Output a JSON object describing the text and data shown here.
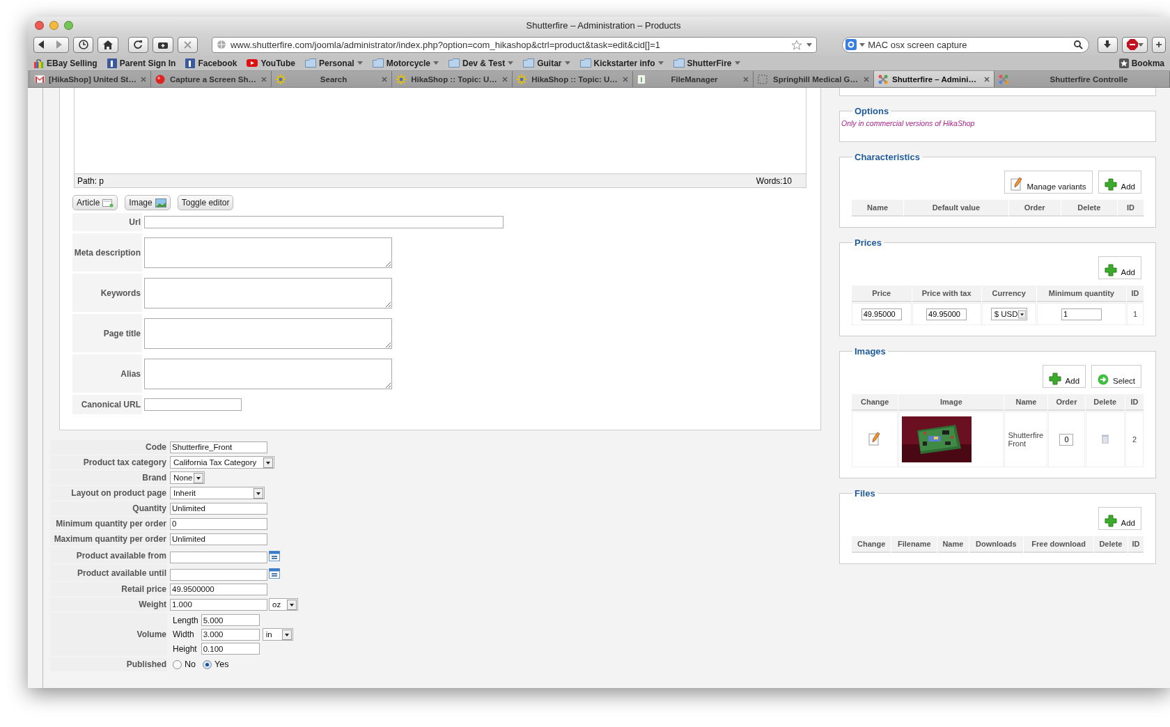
{
  "window": {
    "title": "Shutterfire – Administration – Products"
  },
  "toolbar": {
    "url": "www.shutterfire.com/joomla/administrator/index.php?option=com_hikashop&ctrl=product&task=edit&cid[]=1",
    "search": "MAC osx screen capture"
  },
  "bookmarks": [
    {
      "label": "EBay Selling",
      "kind": "bag"
    },
    {
      "label": "Parent Sign In",
      "kind": "square"
    },
    {
      "label": "Facebook",
      "kind": "square"
    },
    {
      "label": "YouTube",
      "kind": "play"
    },
    {
      "label": "Personal",
      "kind": "folder"
    },
    {
      "label": "Motorcycle",
      "kind": "folder"
    },
    {
      "label": "Dev & Test",
      "kind": "folder"
    },
    {
      "label": "Guitar",
      "kind": "folder"
    },
    {
      "label": "Kickstarter info",
      "kind": "folder"
    },
    {
      "label": "ShutterFire",
      "kind": "folder"
    }
  ],
  "bookmarks_menu": "Bookma",
  "tabs": [
    {
      "label": "[HikaShop] United St…",
      "selected": false
    },
    {
      "label": "Capture a Screen Sh…",
      "selected": false
    },
    {
      "label": "Search",
      "selected": false
    },
    {
      "label": "HikaShop :: Topic: U…",
      "selected": false
    },
    {
      "label": "HikaShop :: Topic: U…",
      "selected": false
    },
    {
      "label": "FileManager",
      "selected": false
    },
    {
      "label": "Springhill Medical G…",
      "selected": false
    },
    {
      "label": "Shutterfire – Admini…",
      "selected": true
    },
    {
      "label": "Shutterfire Controlle",
      "selected": false
    }
  ],
  "editor": {
    "path": "Path: p",
    "words": "Words:10",
    "buttons": [
      "Article",
      "Image",
      "Toggle editor"
    ]
  },
  "seo_fields": [
    {
      "label": "Url",
      "kind": "line"
    },
    {
      "label": "Meta description",
      "kind": "area"
    },
    {
      "label": "Keywords",
      "kind": "area"
    },
    {
      "label": "Page title",
      "kind": "area"
    },
    {
      "label": "Alias",
      "kind": "area"
    },
    {
      "label": "Canonical URL",
      "kind": "short"
    }
  ],
  "product_fields": [
    {
      "label": "Code",
      "kind": "text",
      "value": "Shutterfire_Front"
    },
    {
      "label": "Product tax category",
      "kind": "select",
      "value": "California Tax Category"
    },
    {
      "label": "Brand",
      "kind": "select",
      "value": "None"
    },
    {
      "label": "Layout on product page",
      "kind": "select",
      "value": "Inherit"
    },
    {
      "label": "Quantity",
      "kind": "text",
      "value": "Unlimited"
    },
    {
      "label": "Minimum quantity per order",
      "kind": "text",
      "value": "0"
    },
    {
      "label": "Maximum quantity per order",
      "kind": "text",
      "value": "Unlimited"
    },
    {
      "label": "Product available from",
      "kind": "date"
    },
    {
      "label": "Product available until",
      "kind": "date"
    },
    {
      "label": "Retail price",
      "kind": "text",
      "value": "49.9500000"
    },
    {
      "label": "Weight",
      "kind": "unit",
      "value": "1.000",
      "unit": "oz"
    },
    {
      "label": "Volume",
      "kind": "volume",
      "unit": "in",
      "dims": [
        {
          "label": "Length",
          "value": "5.000"
        },
        {
          "label": "Width",
          "value": "3.000"
        },
        {
          "label": "Height",
          "value": "0.100"
        }
      ]
    },
    {
      "label": "Published",
      "kind": "radio",
      "options": [
        {
          "label": "No",
          "selected": false
        },
        {
          "label": "Yes",
          "selected": true
        }
      ]
    }
  ],
  "options_panel": {
    "title": "Options",
    "note": "Only in commercial versions of HikaShop"
  },
  "characteristics": {
    "title": "Characteristics",
    "buttons": [
      {
        "label": "Manage variants",
        "kind": "edit"
      },
      {
        "label": "Add",
        "kind": "add"
      }
    ],
    "columns": [
      "Name",
      "Default value",
      "Order",
      "Delete",
      "ID"
    ]
  },
  "prices": {
    "title": "Prices",
    "buttons": [
      {
        "label": "Add",
        "kind": "add"
      }
    ],
    "columns": [
      "Price",
      "Price with tax",
      "Currency",
      "Minimum quantity",
      "ID"
    ],
    "rows": [
      {
        "price": "49.95000",
        "price_with_tax": "49.95000",
        "currency": "$ USD",
        "minimum_quantity": "1",
        "id": "1"
      }
    ]
  },
  "images": {
    "title": "Images",
    "buttons": [
      {
        "label": "Add",
        "kind": "add"
      },
      {
        "label": "Select",
        "kind": "select"
      }
    ],
    "columns": [
      "Change",
      "Image",
      "Name",
      "Order",
      "Delete",
      "ID"
    ],
    "rows": [
      {
        "name": "Shutterfire Front",
        "order": "0",
        "id": "2"
      }
    ]
  },
  "files": {
    "title": "Files",
    "buttons": [
      {
        "label": "Add",
        "kind": "add"
      }
    ],
    "columns": [
      "Change",
      "Filename",
      "Name",
      "Downloads",
      "Free download",
      "Delete",
      "ID"
    ]
  }
}
